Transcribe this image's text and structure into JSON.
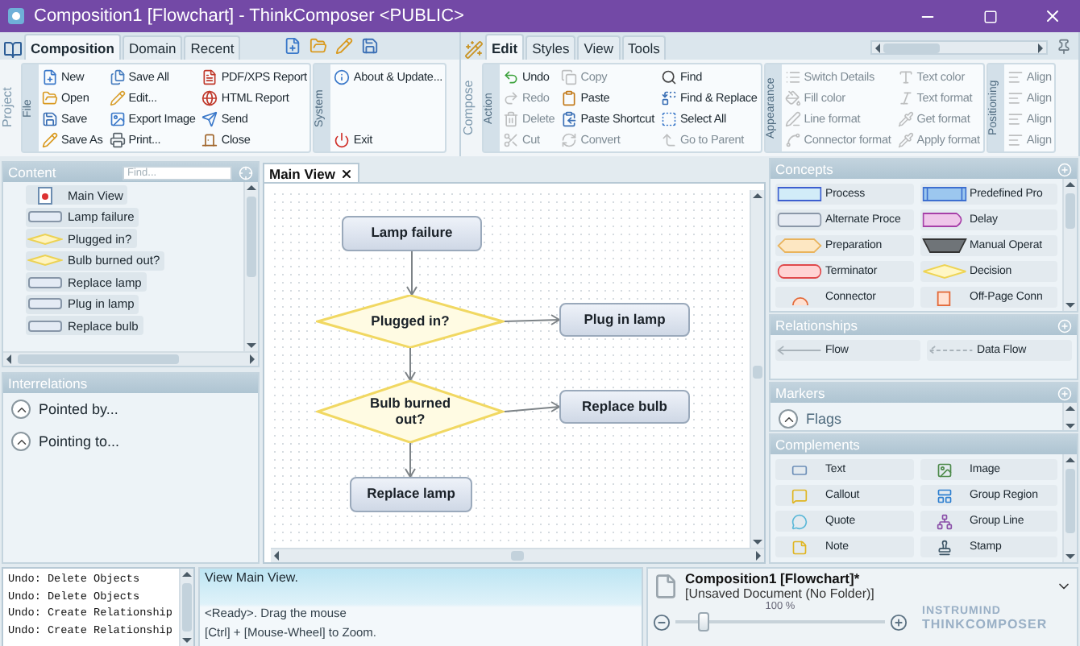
{
  "window": {
    "title": "Composition1 [Flowchart] - ThinkComposer <PUBLIC>"
  },
  "ribbon_left": {
    "tabs": [
      {
        "label": "Composition",
        "selected": true
      },
      {
        "label": "Domain",
        "selected": false
      },
      {
        "label": "Recent",
        "selected": false
      }
    ],
    "side_label": "Project",
    "groups": [
      {
        "label": "File",
        "columns": [
          {
            "items": [
              {
                "label": "New",
                "disabled": false
              },
              {
                "label": "Open",
                "disabled": false
              },
              {
                "label": "Save",
                "disabled": false
              },
              {
                "label": "Save As",
                "disabled": false
              }
            ]
          },
          {
            "items": [
              {
                "label": "Save All",
                "disabled": false
              },
              {
                "label": "Edit...",
                "disabled": false
              },
              {
                "label": "Export Image",
                "disabled": false
              },
              {
                "label": "Print...",
                "disabled": false
              }
            ]
          },
          {
            "items": [
              {
                "label": "PDF/XPS Report",
                "disabled": false
              },
              {
                "label": "HTML Report",
                "disabled": false
              },
              {
                "label": "Send",
                "disabled": false
              },
              {
                "label": "Close",
                "disabled": false
              }
            ]
          }
        ]
      },
      {
        "label": "System",
        "columns": [
          {
            "items": [
              {
                "label": "About & Update...",
                "disabled": false
              },
              {
                "label": "Exit",
                "disabled": false
              }
            ]
          }
        ]
      }
    ]
  },
  "ribbon_right": {
    "tabs": [
      {
        "label": "Edit",
        "selected": true
      },
      {
        "label": "Styles",
        "selected": false
      },
      {
        "label": "View",
        "selected": false
      },
      {
        "label": "Tools",
        "selected": false
      }
    ],
    "side_label": "Compose",
    "groups": [
      {
        "label": "Action",
        "columns": [
          {
            "items": [
              {
                "label": "Undo",
                "disabled": false
              },
              {
                "label": "Redo",
                "disabled": true
              },
              {
                "label": "Delete",
                "disabled": true
              },
              {
                "label": "Cut",
                "disabled": true
              }
            ]
          },
          {
            "items": [
              {
                "label": "Copy",
                "disabled": true
              },
              {
                "label": "Paste",
                "disabled": false
              },
              {
                "label": "Paste Shortcut",
                "disabled": false
              },
              {
                "label": "Convert",
                "disabled": true
              }
            ]
          },
          {
            "items": [
              {
                "label": "Find",
                "disabled": false
              },
              {
                "label": "Find & Replace",
                "disabled": false
              },
              {
                "label": "Select All",
                "disabled": false
              },
              {
                "label": "Go to Parent",
                "disabled": true
              }
            ]
          }
        ]
      },
      {
        "label": "Appearance",
        "columns": [
          {
            "items": [
              {
                "label": "Switch Details",
                "disabled": true
              },
              {
                "label": "Fill color",
                "disabled": true
              },
              {
                "label": "Line format",
                "disabled": true
              },
              {
                "label": "Connector format",
                "disabled": true
              }
            ]
          },
          {
            "items": [
              {
                "label": "Text color",
                "disabled": true
              },
              {
                "label": "Text format",
                "disabled": true
              },
              {
                "label": "Get format",
                "disabled": true
              },
              {
                "label": "Apply format",
                "disabled": true
              }
            ]
          }
        ]
      },
      {
        "label": "Positioning",
        "columns": [
          {
            "items": [
              {
                "label": "Align",
                "disabled": true
              },
              {
                "label": "Align",
                "disabled": true
              },
              {
                "label": "Align",
                "disabled": true
              },
              {
                "label": "Align",
                "disabled": true
              }
            ]
          }
        ]
      }
    ]
  },
  "content_panel": {
    "title": "Content",
    "search": {
      "placeholder": "Find..."
    },
    "items": [
      {
        "label": "Main View",
        "kind": "view"
      },
      {
        "label": "Lamp failure",
        "kind": "process"
      },
      {
        "label": "Plugged in?",
        "kind": "decision"
      },
      {
        "label": "Bulb burned out?",
        "kind": "decision"
      },
      {
        "label": "Replace lamp",
        "kind": "process"
      },
      {
        "label": "Plug in lamp",
        "kind": "process"
      },
      {
        "label": "Replace bulb",
        "kind": "process"
      }
    ]
  },
  "interrelations_panel": {
    "title": "Interrelations",
    "items": [
      {
        "label": "Pointed by..."
      },
      {
        "label": "Pointing to..."
      }
    ]
  },
  "document_tabs": [
    {
      "label": "Main View",
      "selected": true
    }
  ],
  "diagram": {
    "nodes": [
      {
        "label": "Lamp failure",
        "kind": "process"
      },
      {
        "label": "Plugged in?",
        "kind": "decision"
      },
      {
        "label": "Plug in lamp",
        "kind": "process"
      },
      {
        "label": "Bulb burned out?",
        "kind": "decision"
      },
      {
        "label": "Replace bulb",
        "kind": "process"
      },
      {
        "label": "Replace lamp",
        "kind": "process"
      }
    ]
  },
  "concepts": {
    "title": "Concepts",
    "items": [
      {
        "label": "Process",
        "kind": "process"
      },
      {
        "label": "Predefined Pro",
        "kind": "predefined"
      },
      {
        "label": "Alternate Proce",
        "kind": "alternate"
      },
      {
        "label": "Delay",
        "kind": "delay"
      },
      {
        "label": "Preparation",
        "kind": "preparation"
      },
      {
        "label": "Manual Operat",
        "kind": "manual"
      },
      {
        "label": "Terminator",
        "kind": "terminator"
      },
      {
        "label": "Decision",
        "kind": "decision"
      },
      {
        "label": "Connector",
        "kind": "connector"
      },
      {
        "label": "Off-Page Conn",
        "kind": "offpage"
      }
    ]
  },
  "relationships": {
    "title": "Relationships",
    "items": [
      {
        "label": "Flow",
        "kind": "solid"
      },
      {
        "label": "Data Flow",
        "kind": "dashed"
      }
    ]
  },
  "markers": {
    "title": "Markers",
    "items": [
      {
        "label": "Flags"
      }
    ]
  },
  "complements": {
    "title": "Complements",
    "items": [
      {
        "label": "Text"
      },
      {
        "label": "Image"
      },
      {
        "label": "Callout"
      },
      {
        "label": "Group Region"
      },
      {
        "label": "Quote"
      },
      {
        "label": "Group Line"
      },
      {
        "label": "Note"
      },
      {
        "label": "Stamp"
      }
    ]
  },
  "undo_log": [
    "Undo: Delete Objects",
    "Undo: Delete Objects",
    "Undo: Create Relationship",
    "Undo: Create Relationship"
  ],
  "status": {
    "message": "View Main View.",
    "lines": [
      "<Ready>. Drag the mouse",
      "[Ctrl] + [Mouse-Wheel] to Zoom."
    ]
  },
  "document": {
    "title": "Composition1 [Flowchart]*",
    "location": "[Unsaved Document (No Folder)]",
    "zoom": {
      "label": "100 %",
      "level": 0.13
    }
  },
  "logo": {
    "line_1": "INSTRUMIND",
    "line_2": "THINKCOMPOSER"
  }
}
